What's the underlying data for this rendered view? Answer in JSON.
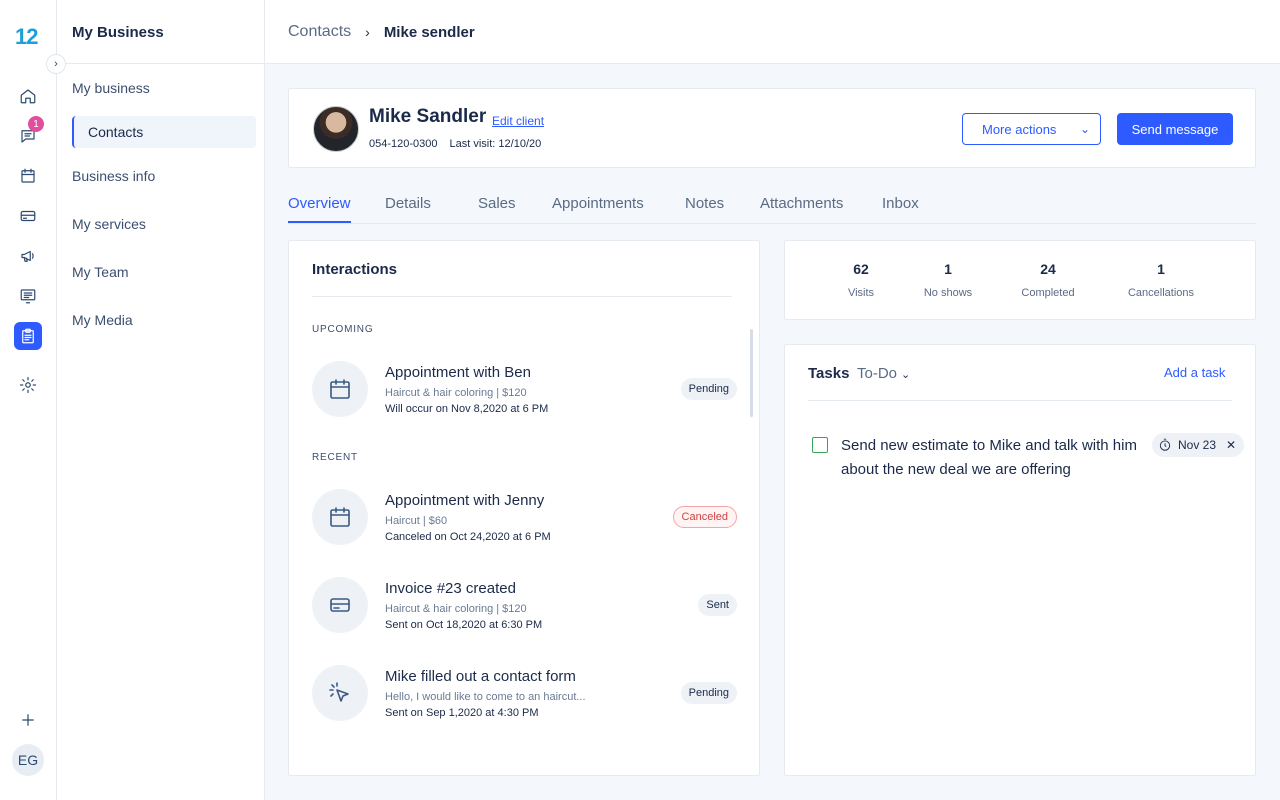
{
  "app": {
    "logo": "12"
  },
  "rail": {
    "messages_badge": "1",
    "user_initials": "EG"
  },
  "sidebar": {
    "title": "My Business",
    "items": [
      {
        "label": "My business"
      },
      {
        "label": "Contacts"
      },
      {
        "label": "Business info"
      },
      {
        "label": "My services"
      },
      {
        "label": "My Team"
      },
      {
        "label": "My Media"
      }
    ]
  },
  "breadcrumb": {
    "parent": "Contacts",
    "separator": "›",
    "current": "Mike sendler"
  },
  "client": {
    "name": "Mike Sandler",
    "edit_label": "Edit client",
    "phone": "054-120-0300",
    "last_visit": "Last visit: 12/10/20",
    "more_actions_label": "More actions",
    "send_message_label": "Send message"
  },
  "tabs": [
    {
      "label": "Overview"
    },
    {
      "label": "Details"
    },
    {
      "label": "Sales"
    },
    {
      "label": "Appointments"
    },
    {
      "label": "Notes"
    },
    {
      "label": "Attachments"
    },
    {
      "label": "Inbox"
    }
  ],
  "interactions": {
    "title": "Interactions",
    "upcoming_label": "UPCOMING",
    "recent_label": "RECENT",
    "upcoming": [
      {
        "icon": "calendar-icon",
        "title": "Appointment with Ben",
        "subtitle": "Haircut & hair coloring | $120",
        "time": "Will occur on Nov 8,2020 at 6 PM",
        "status": "Pending"
      }
    ],
    "recent": [
      {
        "icon": "calendar-icon",
        "title": "Appointment with Jenny",
        "subtitle": "Haircut  | $60",
        "time": "Canceled on Oct 24,2020 at 6 PM",
        "status": "Canceled"
      },
      {
        "icon": "credit-card-icon",
        "title": "Invoice #23 created",
        "subtitle": "Haircut & hair coloring | $120",
        "time": "Sent on Oct 18,2020 at 6:30 PM",
        "status": "Sent"
      },
      {
        "icon": "cursor-click-icon",
        "title": "Mike filled out a contact form",
        "subtitle": "Hello, I would like to come to an haircut...",
        "time": "Sent on Sep 1,2020 at 4:30 PM",
        "status": "Pending"
      }
    ]
  },
  "stats": [
    {
      "value": "62",
      "label": "Visits"
    },
    {
      "value": "1",
      "label": "No shows"
    },
    {
      "value": "24",
      "label": "Completed"
    },
    {
      "value": "1",
      "label": "Cancellations"
    }
  ],
  "tasks": {
    "title": "Tasks",
    "filter": "To-Do",
    "add_label": "Add a task",
    "items": [
      {
        "text": "Send new estimate to Mike and talk with him about the new deal we are offering",
        "due": "Nov 23",
        "done": false
      }
    ]
  },
  "colors": {
    "accent": "#2d5bff",
    "badge": "#e04f9c",
    "canceled": "#d04242",
    "check": "#35a855"
  }
}
